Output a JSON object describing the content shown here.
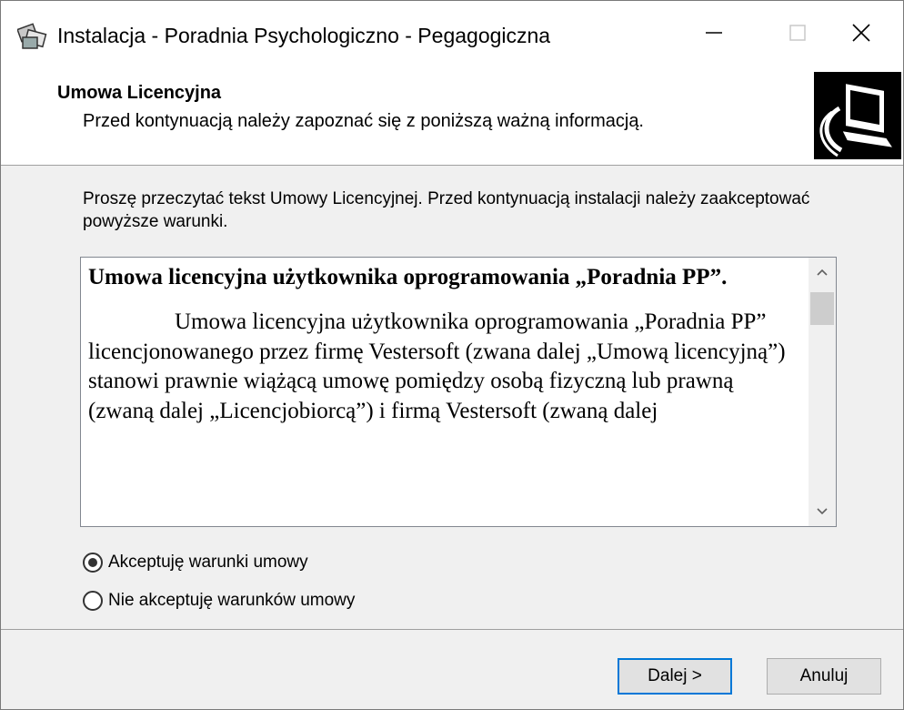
{
  "window": {
    "title": "Instalacja - Poradnia Psychologiczno - Pegagogiczna",
    "icons": {
      "app": "installer-icon",
      "minimize": "minimize-icon",
      "maximize": "maximize-icon",
      "close": "close-icon"
    }
  },
  "header": {
    "title": "Umowa Licencyjna",
    "subtitle": "Przed kontynuacją należy zapoznać się z poniższą ważną informacją.",
    "image_icon": "computer-icon"
  },
  "body": {
    "intro": "Proszę przeczytać tekst Umowy Licencyjnej. Przed kontynuacją instalacji należy zaakceptować powyższe warunki.",
    "license": {
      "title": "Umowa licencyjna użytkownika oprogramowania „Poradnia PP”.",
      "text": "Umowa licencyjna użytkownika oprogramowania „Poradnia PP” licencjonowanego przez firmę Vestersoft (zwana dalej „Umową licencyjną”) stanowi prawnie wiążącą umowę pomiędzy osobą fizyczną lub prawną (zwaną dalej „Licencjobiorcą”) i firmą Vestersoft (zwaną dalej"
    },
    "radios": [
      {
        "label": "Akceptuję warunki umowy",
        "checked": true
      },
      {
        "label": "Nie akceptuję warunków umowy",
        "checked": false
      }
    ]
  },
  "footer": {
    "next_label": "Dalej >",
    "cancel_label": "Anuluj"
  },
  "colors": {
    "focus_border": "#0078d7",
    "header_image_bg": "#000000"
  }
}
